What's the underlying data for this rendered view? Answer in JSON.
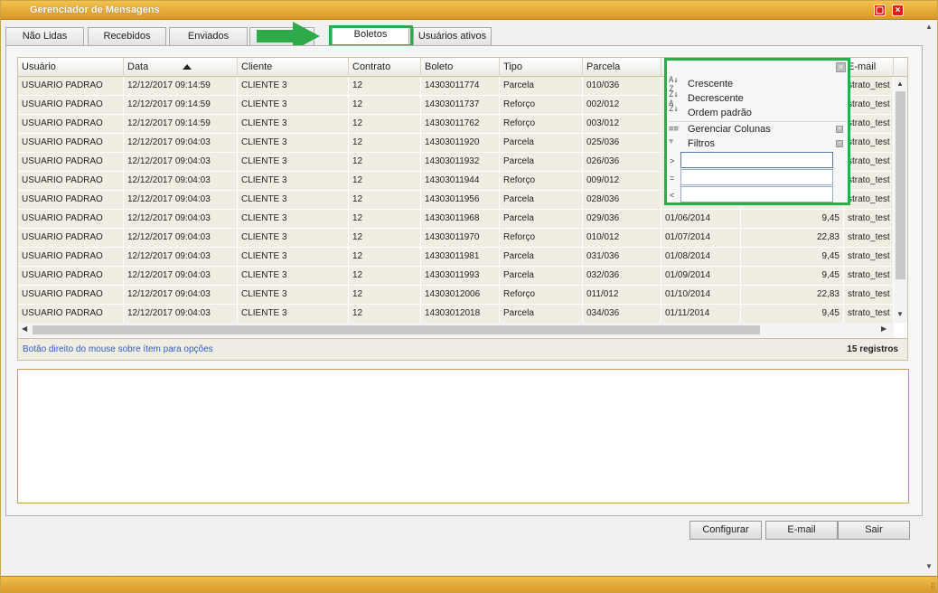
{
  "window": {
    "title": "Gerenciador de Mensagens"
  },
  "tabs": [
    {
      "label": "Não Lidas"
    },
    {
      "label": "Recebidos"
    },
    {
      "label": "Enviados"
    },
    {
      "label": "Boletos"
    },
    {
      "label": "Usuários ativos"
    }
  ],
  "active_tab": "Boletos",
  "grid": {
    "columns": [
      "Usuário",
      "Data",
      "Cliente",
      "Contrato",
      "Boleto",
      "Tipo",
      "Parcela",
      "",
      "",
      "E-mail"
    ],
    "sorted_column": "Data",
    "rows": [
      [
        "USUARIO PADRAO",
        "12/12/2017 09:14:59",
        "CLIENTE 3",
        "12",
        "14303011774",
        "Parcela",
        "010/036",
        "",
        "",
        "strato_test"
      ],
      [
        "USUARIO PADRAO",
        "12/12/2017 09:14:59",
        "CLIENTE 3",
        "12",
        "14303011737",
        "Reforço",
        "002/012",
        "",
        "",
        "strato_test"
      ],
      [
        "USUARIO PADRAO",
        "12/12/2017 09:14:59",
        "CLIENTE 3",
        "12",
        "14303011762",
        "Reforço",
        "003/012",
        "",
        "",
        "strato_test"
      ],
      [
        "USUARIO PADRAO",
        "12/12/2017 09:04:03",
        "CLIENTE 3",
        "12",
        "14303011920",
        "Parcela",
        "025/036",
        "",
        "",
        "strato_test"
      ],
      [
        "USUARIO PADRAO",
        "12/12/2017 09:04:03",
        "CLIENTE 3",
        "12",
        "14303011932",
        "Parcela",
        "026/036",
        "",
        "",
        "strato_test"
      ],
      [
        "USUARIO PADRAO",
        "12/12/2017 09:04:03",
        "CLIENTE 3",
        "12",
        "14303011944",
        "Reforço",
        "009/012",
        "",
        "",
        "strato_test"
      ],
      [
        "USUARIO PADRAO",
        "12/12/2017 09:04:03",
        "CLIENTE 3",
        "12",
        "14303011956",
        "Parcela",
        "028/036",
        "",
        "",
        "strato_test"
      ],
      [
        "USUARIO PADRAO",
        "12/12/2017 09:04:03",
        "CLIENTE 3",
        "12",
        "14303011968",
        "Parcela",
        "029/036",
        "01/06/2014",
        "9,45",
        "strato_test"
      ],
      [
        "USUARIO PADRAO",
        "12/12/2017 09:04:03",
        "CLIENTE 3",
        "12",
        "14303011970",
        "Reforço",
        "010/012",
        "01/07/2014",
        "22,83",
        "strato_test"
      ],
      [
        "USUARIO PADRAO",
        "12/12/2017 09:04:03",
        "CLIENTE 3",
        "12",
        "14303011981",
        "Parcela",
        "031/036",
        "01/08/2014",
        "9,45",
        "strato_test"
      ],
      [
        "USUARIO PADRAO",
        "12/12/2017 09:04:03",
        "CLIENTE 3",
        "12",
        "14303011993",
        "Parcela",
        "032/036",
        "01/09/2014",
        "9,45",
        "strato_test"
      ],
      [
        "USUARIO PADRAO",
        "12/12/2017 09:04:03",
        "CLIENTE 3",
        "12",
        "14303012006",
        "Reforço",
        "011/012",
        "01/10/2014",
        "22,83",
        "strato_test"
      ],
      [
        "USUARIO PADRAO",
        "12/12/2017 09:04:03",
        "CLIENTE 3",
        "12",
        "14303012018",
        "Parcela",
        "034/036",
        "01/11/2014",
        "9,45",
        "strato_test"
      ]
    ]
  },
  "status": {
    "hint": "Botão direito do mouse sobre ítem para opções",
    "count": "15 registros"
  },
  "context_menu": {
    "asc": "Crescente",
    "desc": "Decrescente",
    "default_order": "Ordem padrão",
    "manage_columns": "Gerenciar Colunas",
    "filters": "Filtros",
    "filter_ops": [
      ">",
      "=",
      "<"
    ]
  },
  "buttons": {
    "configure": "Configurar",
    "email": "E-mail",
    "exit": "Sair"
  },
  "colors": {
    "title_bar": "#d9982a",
    "highlight": "#2eaa4a",
    "row_bg": "#f0eee2"
  }
}
